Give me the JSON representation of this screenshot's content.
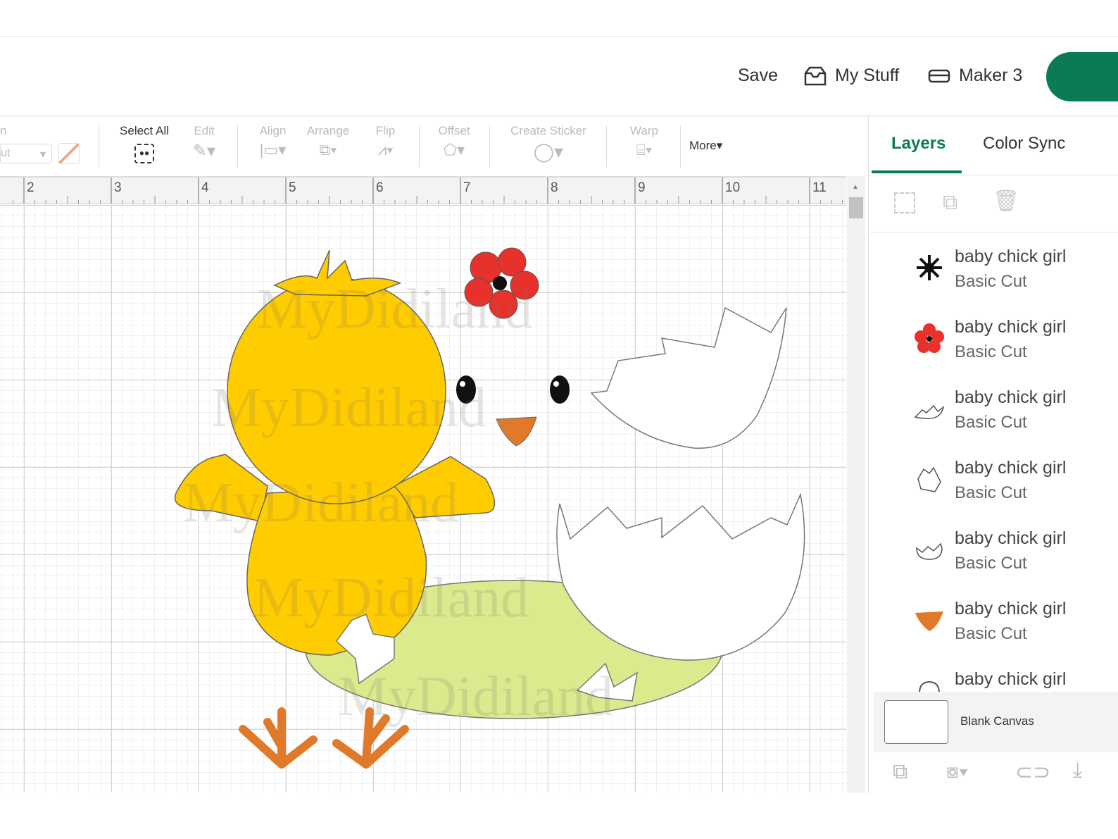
{
  "header": {
    "save": "Save",
    "my_stuff": "My Stuff",
    "machine": "Maker 3"
  },
  "toolbar": {
    "operation_label": "n",
    "operation_value": "ut",
    "select_all": "Select All",
    "edit": "Edit",
    "align": "Align",
    "arrange": "Arrange",
    "flip": "Flip",
    "offset": "Offset",
    "create_sticker": "Create Sticker",
    "warp": "Warp",
    "more": "More"
  },
  "ruler": {
    "labels": [
      "2",
      "3",
      "4",
      "5",
      "6",
      "7",
      "8",
      "9",
      "10",
      "11"
    ]
  },
  "canvas": {
    "watermark": "MyDidiland"
  },
  "panel": {
    "tabs": [
      "Layers",
      "Color Sync"
    ],
    "layers": [
      {
        "name": "baby chick girl",
        "op": "Basic Cut",
        "icon": "flower-center-black"
      },
      {
        "name": "baby chick girl",
        "op": "Basic Cut",
        "icon": "flower-red"
      },
      {
        "name": "baby chick girl",
        "op": "Basic Cut",
        "icon": "eggshell-top-outline"
      },
      {
        "name": "baby chick girl",
        "op": "Basic Cut",
        "icon": "eggshell-piece-outline"
      },
      {
        "name": "baby chick girl",
        "op": "Basic Cut",
        "icon": "eggshell-bottom-outline"
      },
      {
        "name": "baby chick girl",
        "op": "Basic Cut",
        "icon": "beak-orange"
      },
      {
        "name": "baby chick girl",
        "op": "",
        "icon": "arch-outline"
      }
    ],
    "blank_canvas": "Blank Canvas"
  },
  "colors": {
    "accent": "#0a7b52",
    "chick": "#ffcc00",
    "grass": "#dcea8e",
    "feet": "#e07a2a",
    "flower": "#e8312a"
  }
}
